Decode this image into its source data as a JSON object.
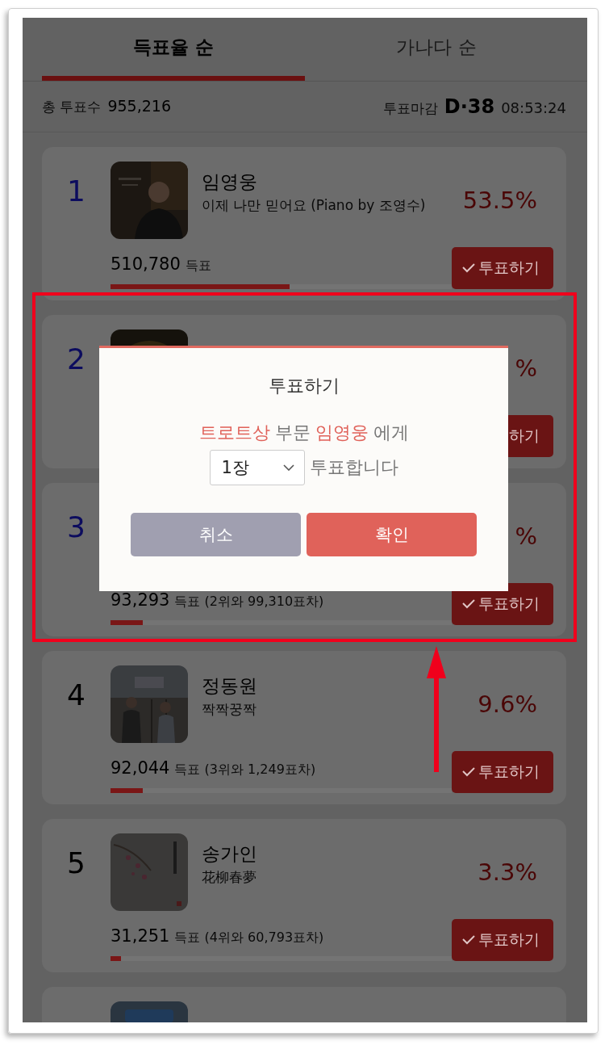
{
  "tabs": [
    {
      "label": "득표율 순",
      "selected": true
    },
    {
      "label": "가나다 순",
      "selected": false
    }
  ],
  "summary": {
    "total_label": "총 투표수",
    "total": "955,216",
    "deadline_label": "투표마감",
    "d_day": "D·38",
    "time": "08:53:24"
  },
  "candidates": [
    {
      "rank": "1",
      "top": true,
      "cover": {
        "kind": "picture"
      },
      "name": "임영웅",
      "song": "이제 나만 믿어요 (Piano by 조영수)",
      "percent": "53.5%",
      "votes": "510,780",
      "unit": "득표",
      "level": 0.525,
      "vote_button": {
        "label": "투표하기",
        "check": true
      }
    },
    {
      "rank": "2",
      "top": true,
      "cover": {
        "kind": "picture"
      },
      "percent": "%",
      "vote_button": {
        "label": "하기"
      }
    },
    {
      "rank": "3",
      "top": true,
      "percent": "%",
      "votes": "93,293",
      "unit": "득표",
      "gap": "(2위와 99,310표차)",
      "level": 0.095,
      "vote_button": {
        "label": "투표하기",
        "check": true
      }
    },
    {
      "rank": "4",
      "top": false,
      "cover": {
        "kind": "picture"
      },
      "name": "정동원",
      "song": "짝짝꿍짝",
      "percent": "9.6%",
      "votes": "92,044",
      "unit": "득표",
      "gap": "(3위와 1,249표차)",
      "level": 0.095,
      "vote_button": {
        "label": "투표하기",
        "check": true
      }
    },
    {
      "rank": "5",
      "top": false,
      "cover": {
        "kind": "picture"
      },
      "name": "송가인",
      "song": "花柳春夢",
      "percent": "3.3%",
      "votes": "31,251",
      "unit": "득표",
      "gap": "(4위와 60,793표차)",
      "level": 0.03,
      "vote_button": {
        "label": "투표하기",
        "check": true
      }
    },
    {
      "cover": {
        "kind": "picture"
      }
    }
  ],
  "dialog": {
    "title": "투표하기",
    "message": [
      {
        "text": "트로트상",
        "highlight": true
      },
      {
        "text": "부문",
        "highlight": false
      },
      {
        "text": "임영웅",
        "highlight": true
      },
      {
        "text": "에게",
        "highlight": false
      }
    ],
    "select": {
      "value": "1장"
    },
    "suffix": "투표합니다",
    "buttons": [
      {
        "label": "취소",
        "kind": "cancel"
      },
      {
        "label": "확인",
        "kind": "confirm"
      }
    ]
  }
}
